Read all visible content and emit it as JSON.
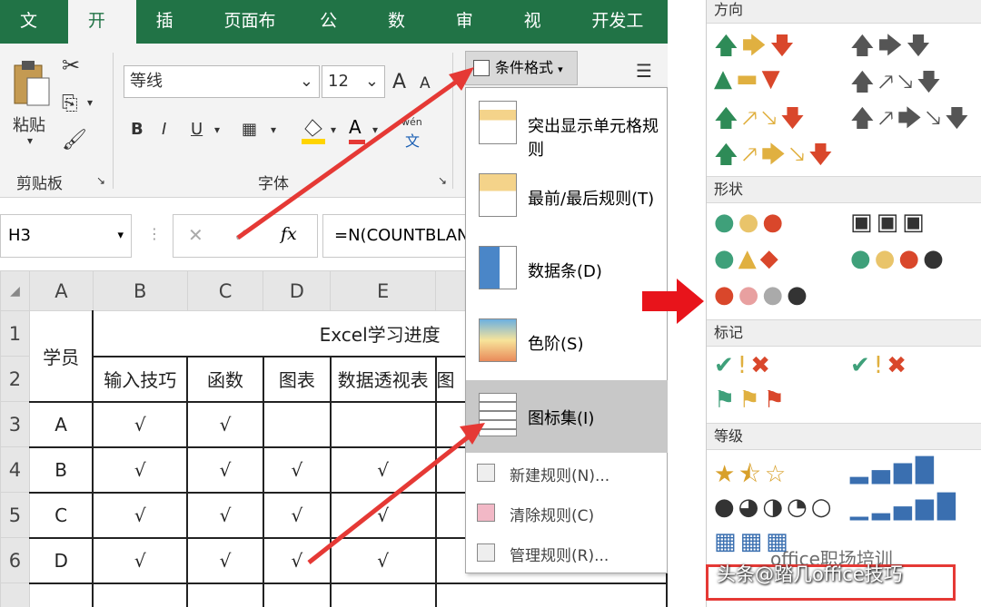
{
  "tabs": [
    "文件",
    "开始",
    "插入",
    "页面布局",
    "公式",
    "数据",
    "审阅",
    "视图",
    "开发工具"
  ],
  "ribbon": {
    "paste_label": "粘贴",
    "clipboard_label": "剪贴板",
    "font_label": "字体",
    "font_name": "等线",
    "font_size": "12",
    "bold": "B",
    "italic": "I",
    "underline": "U",
    "font_color": "A",
    "grow_font": "A",
    "shrink_font": "A",
    "phonetic": "wén",
    "cond_format_label": "条件格式"
  },
  "formula_bar": {
    "namebox": "H3",
    "fx": "fx",
    "formula": "=N(COUNTBLAN"
  },
  "sheet": {
    "columns": [
      "A",
      "B",
      "C",
      "D",
      "E"
    ],
    "rows": [
      "1",
      "2",
      "3",
      "4",
      "5",
      "6"
    ],
    "merged_title": "Excel学习进度",
    "header_a": "学员",
    "subheaders": [
      "输入技巧",
      "函数",
      "图表",
      "数据透视表",
      "图"
    ],
    "data": [
      {
        "name": "A",
        "vals": [
          "√",
          "√",
          "",
          ""
        ]
      },
      {
        "name": "B",
        "vals": [
          "√",
          "√",
          "√",
          "√"
        ]
      },
      {
        "name": "C",
        "vals": [
          "√",
          "√",
          "√",
          "√"
        ]
      },
      {
        "name": "D",
        "vals": [
          "√",
          "√",
          "√",
          "√"
        ]
      }
    ]
  },
  "cf_menu": {
    "items": [
      "突出显示单元格规则",
      "最前/最后规则(T)",
      "数据条(D)",
      "色阶(S)",
      "图标集(I)"
    ],
    "small_items": [
      "新建规则(N)...",
      "清除规则(C)",
      "管理规则(R)..."
    ]
  },
  "icon_panel": {
    "sections": [
      "方向",
      "形状",
      "标记",
      "等级"
    ]
  },
  "watermark": {
    "text1": "头条@踏几office技巧",
    "text2": "office职场培训"
  }
}
